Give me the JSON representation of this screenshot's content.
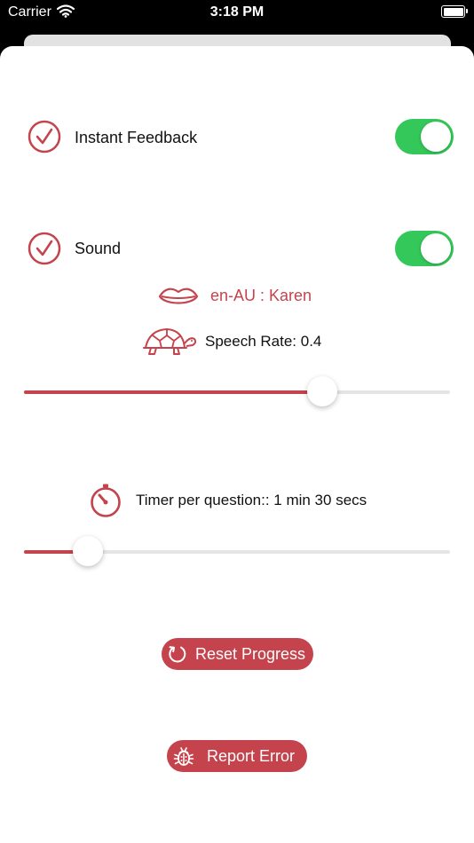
{
  "status_bar": {
    "carrier": "Carrier",
    "time": "3:18 PM"
  },
  "settings": {
    "instant_feedback": {
      "label": "Instant Feedback",
      "enabled": true
    },
    "sound": {
      "label": "Sound",
      "enabled": true
    },
    "voice": {
      "label": "en-AU : Karen"
    },
    "speech_rate": {
      "label": "Speech Rate: 0.4",
      "value": 0.7
    },
    "timer": {
      "label": "Timer per question:: 1 min 30 secs",
      "value": 0.15
    }
  },
  "actions": {
    "reset_label": "Reset Progress",
    "report_label": "Report Error"
  },
  "colors": {
    "accent": "#c4434c",
    "toggle_on": "#34c759",
    "track": "#e5e5e5"
  },
  "icons": {
    "instant_feedback": "check-circle-icon",
    "sound": "check-circle-icon",
    "voice": "lips-icon",
    "speech_rate": "turtle-icon",
    "timer": "stopwatch-icon",
    "reset": "reset-icon",
    "report": "bug-icon"
  }
}
